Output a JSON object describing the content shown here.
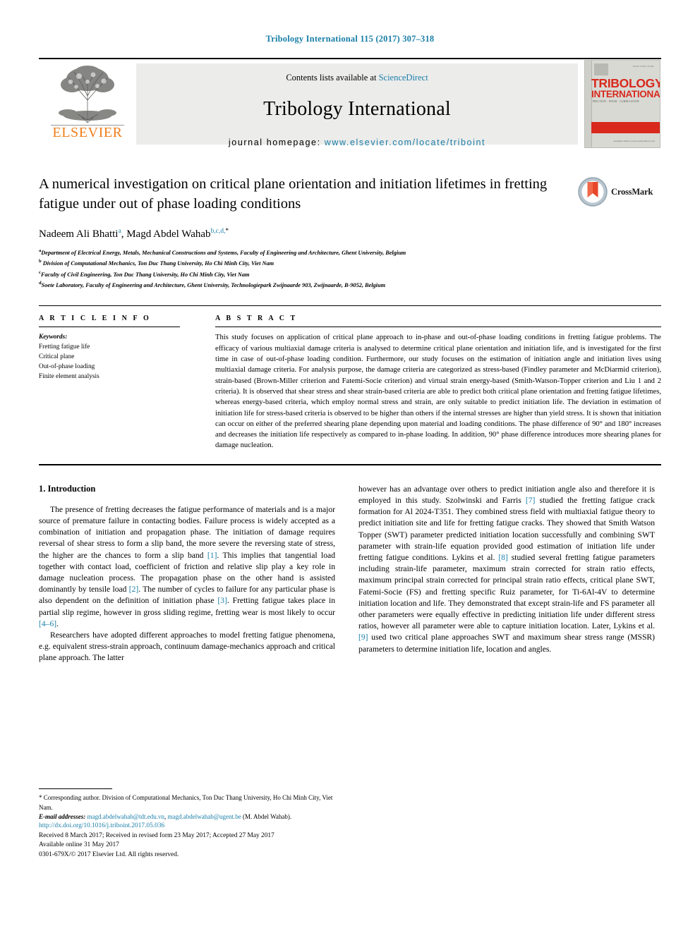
{
  "running_head": "Tribology International 115 (2017) 307–318",
  "masthead": {
    "publisher_name": "ELSEVIER",
    "contents_prefix": "Contents lists available at ",
    "contents_link": "ScienceDirect",
    "journal_name": "Tribology International",
    "homepage_label": "journal homepage: ",
    "homepage_url": "www.elsevier.com/locate/triboint",
    "cover": {
      "title_line1": "TRIBOLOGY",
      "title_line2": "INTERNATIONAL",
      "top_text": "ISSN 0301-679X",
      "sub_text": "FRICTION · WEAR · LUBRICATION",
      "bottom_text": "Available online at\nwww.sciencedirect.com"
    }
  },
  "article": {
    "title": "A numerical investigation on critical plane orientation and initiation lifetimes in fretting fatigue under out of phase loading conditions",
    "crossmark_label": "CrossMark",
    "authors": [
      {
        "name": "Nadeem Ali Bhatti",
        "marks": "a"
      },
      {
        "name": "Magd Abdel Wahab",
        "marks": "b,c,d,"
      }
    ],
    "author_line_separator": ", ",
    "corresponding_star": "*",
    "affiliations": [
      {
        "mark": "a",
        "text": "Department of Electrical Energy, Metals, Mechanical Constructions and Systems, Faculty of Engineering and Architecture, Ghent University, Belgium"
      },
      {
        "mark": "b",
        "text": "Division of Computational Mechanics, Ton Duc Thang University, Ho Chi Minh City, Viet Nam"
      },
      {
        "mark": "c",
        "text": "Faculty of Civil Engineering, Ton Duc Thang University, Ho Chi Minh City, Viet Nam"
      },
      {
        "mark": "d",
        "text": "Soete Laboratory, Faculty of Engineering and Architecture, Ghent University, Technologiepark Zwijnaarde 903, Zwijnaarde, B-9052, Belgium"
      }
    ]
  },
  "article_info": {
    "heading": "A R T I C L E   I N F O",
    "keywords_label": "Keywords:",
    "keywords": [
      "Fretting fatigue life",
      "Critical plane",
      "Out-of-phase loading",
      "Finite element analysis"
    ]
  },
  "abstract": {
    "heading": "A B S T R A C T",
    "text": "This study focuses on application of critical plane approach to in-phase and out-of-phase loading conditions in fretting fatigue problems. The efficacy of various multiaxial damage criteria is analysed to determine critical plane orientation and initiation life, and is investigated for the first time in case of out-of-phase loading condition. Furthermore, our study focuses on the estimation of initiation angle and initiation lives using multiaxial damage criteria. For analysis purpose, the damage criteria are categorized as stress-based (Findley parameter and McDiarmid criterion), strain-based (Brown-Miller criterion and Fatemi-Socie criterion) and virtual strain energy-based (Smith-Watson-Topper criterion and Liu 1 and 2 criteria). It is observed that shear stress and shear strain-based criteria are able to predict both critical plane orientation and fretting fatigue lifetimes, whereas energy-based criteria, which employ normal stress and strain, are only suitable to predict initiation life. The deviation in estimation of initiation life for stress-based criteria is observed to be higher than others if the internal stresses are higher than yield stress. It is shown that initiation can occur on either of the preferred shearing plane depending upon material and loading conditions. The phase difference of 90° and 180° increases and decreases the initiation life respectively as compared to in-phase loading. In addition, 90° phase difference introduces more shearing planes for damage nucleation."
  },
  "body": {
    "section_number_title": "1.  Introduction",
    "left_column": {
      "para1_a": "The presence of fretting decreases the fatigue performance of materials and is a major source of premature failure in contacting bodies. Failure process is widely accepted as a combination of initiation and propagation phase. The initiation of damage requires reversal of shear stress to form a slip band, the more severe the reversing state of stress, the higher are the chances to form a slip band ",
      "ref1": "[1]",
      "para1_b": ". This implies that tangential load together with contact load, coefficient of friction and relative slip play a key role in damage nucleation process. The propagation phase on the other hand is assisted dominantly by tensile load ",
      "ref2": "[2]",
      "para1_c": ". The number of cycles to failure for any particular phase is also dependent on the definition of initiation phase ",
      "ref3": "[3]",
      "para1_d": ". Fretting fatigue takes place in partial slip regime, however in gross sliding regime, fretting wear is most likely to occur ",
      "ref4": "[4–6]",
      "para1_e": ".",
      "para2": "Researchers have adopted different approaches to model fretting fatigue phenomena, e.g. equivalent stress-strain approach, continuum damage-mechanics approach and critical plane approach. The latter"
    },
    "right_column": {
      "part_a": "however has an advantage over others to predict initiation angle also and therefore it is employed in this study. Szolwinski and Farris ",
      "ref7": "[7]",
      "part_b": " studied the fretting fatigue crack formation for Al 2024-T351. They combined stress field with multiaxial fatigue theory to predict initiation site and life for fretting fatigue cracks. They showed that Smith Watson Topper (SWT) parameter predicted initiation location successfully and combining SWT parameter with strain-life equation provided good estimation of initiation life under fretting fatigue conditions. Lykins et al. ",
      "ref8": "[8]",
      "part_c": " studied several fretting fatigue parameters including strain-life parameter, maximum strain corrected for strain ratio effects, maximum principal strain corrected for principal strain ratio effects, critical plane SWT, Fatemi-Socie (FS) and fretting specific Ruiz parameter, for Ti-6Al-4V to determine initiation location and life. They demonstrated that except strain-life and FS parameter all other parameters were equally effective in predicting initiation life under different stress ratios, however all parameter were able to capture initiation location. Later, Lykins et al. ",
      "ref9": "[9]",
      "part_d": " used two critical plane approaches SWT and maximum shear stress range (MSSR) parameters to determine initiation life, location and angles."
    }
  },
  "footnote": {
    "star": "*",
    "corresponding_text": " Corresponding author. Division of Computational Mechanics, Ton Duc Thang University, Ho Chi Minh City, Viet Nam.",
    "email_label": "E-mail addresses:",
    "email1": "magd.abdelwahab@tdt.edu.vn",
    "email_sep": ", ",
    "email2": "magd.abdelwahab@ugent.be",
    "email_suffix": " (M. Abdel Wahab)."
  },
  "colophon": {
    "doi": "http://dx.doi.org/10.1016/j.triboint.2017.05.036",
    "dates": "Received 8 March 2017; Received in revised form 23 May 2017; Accepted 27 May 2017",
    "available": "Available online 31 May 2017",
    "copyright": "0301-679X/© 2017 Elsevier Ltd. All rights reserved."
  },
  "colors": {
    "link_blue": "#1a7fa8",
    "elsevier_orange": "#ef7f1a",
    "cover_red": "#d8291c"
  }
}
